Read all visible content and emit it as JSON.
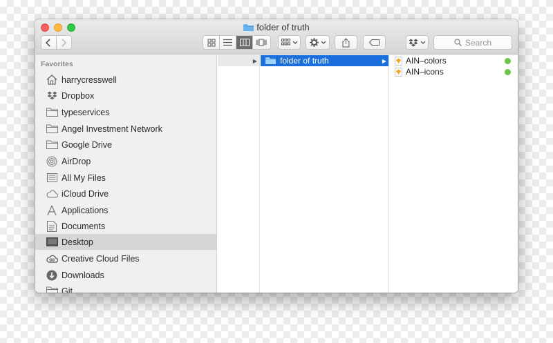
{
  "window": {
    "title": "folder of truth"
  },
  "toolbar": {
    "search_placeholder": "Search",
    "nav_back": "back-chevron-icon",
    "nav_forward": "forward-chevron-icon"
  },
  "sidebar": {
    "heading": "Favorites",
    "items": [
      {
        "label": "harrycresswell",
        "icon": "home-icon"
      },
      {
        "label": "Dropbox",
        "icon": "dropbox-icon"
      },
      {
        "label": "typeservices",
        "icon": "folder-icon"
      },
      {
        "label": "Angel Investment Network",
        "icon": "folder-icon"
      },
      {
        "label": "Google Drive",
        "icon": "folder-icon"
      },
      {
        "label": "AirDrop",
        "icon": "airdrop-icon"
      },
      {
        "label": "All My Files",
        "icon": "files-icon"
      },
      {
        "label": "iCloud Drive",
        "icon": "cloud-icon"
      },
      {
        "label": "Applications",
        "icon": "applications-icon"
      },
      {
        "label": "Documents",
        "icon": "documents-icon"
      },
      {
        "label": "Desktop",
        "icon": "desktop-icon"
      },
      {
        "label": "Creative Cloud Files",
        "icon": "creative-cloud-icon"
      },
      {
        "label": "Downloads",
        "icon": "downloads-icon"
      },
      {
        "label": "Git",
        "icon": "folder-icon"
      }
    ],
    "selected_label": "Desktop"
  },
  "columns": {
    "folder": {
      "label": "folder of truth"
    },
    "files": [
      {
        "label": "AIN–colors",
        "status_color": "#6cc54a"
      },
      {
        "label": "AIN–icons",
        "status_color": "#6cc54a"
      }
    ]
  },
  "colors": {
    "selection": "#1a6fdc",
    "sync_dot": "#6cc54a"
  }
}
